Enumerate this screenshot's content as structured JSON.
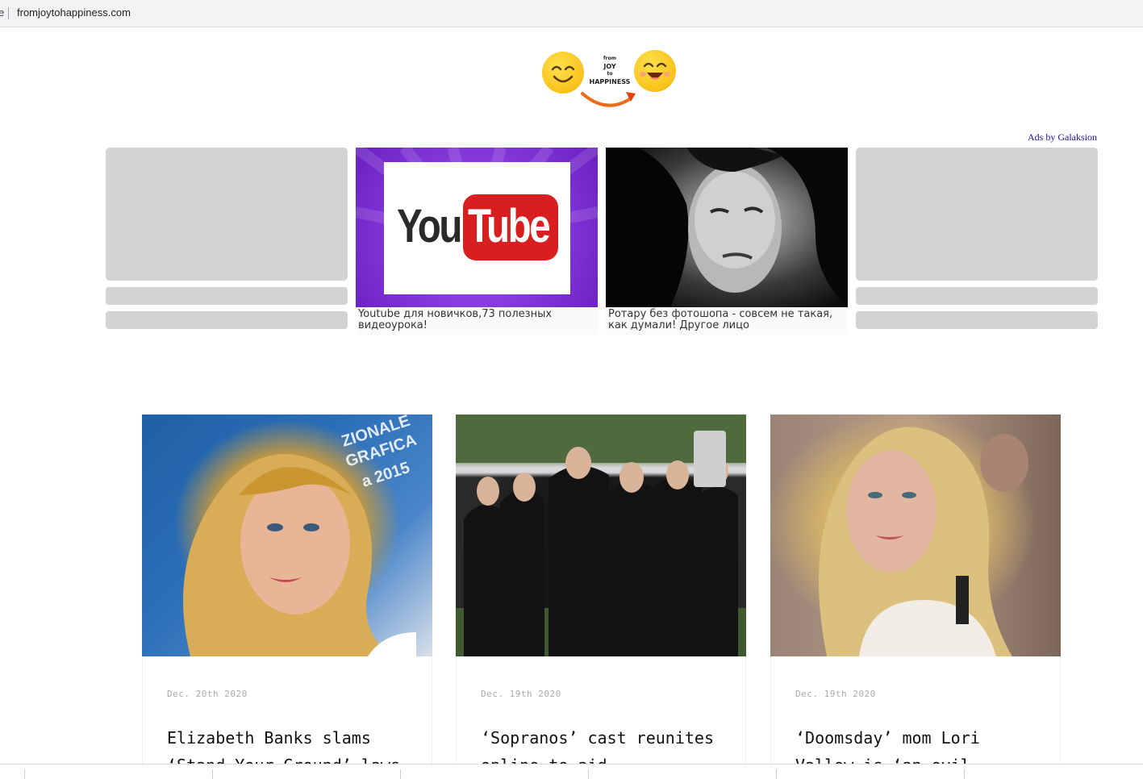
{
  "browser": {
    "edge_char": "e",
    "url": "fromjoytohappiness.com"
  },
  "logo": {
    "line1": "from",
    "line2": "JOY",
    "line3": "to",
    "line4": "HAPPINESS"
  },
  "ads": {
    "label": "Ads by Galaksion",
    "items": [
      {
        "type": "placeholder",
        "caption": ""
      },
      {
        "type": "youtube",
        "image_text_left": "You",
        "image_text_right": "Tube",
        "caption": "Youtube для новичков,73 полезных видеоурока!"
      },
      {
        "type": "photo",
        "caption": "Ротару без фотошопа - совсем не такая, как думали! Другое лицо"
      },
      {
        "type": "placeholder",
        "caption": ""
      }
    ]
  },
  "articles": [
    {
      "date": "Dec. 20th 2020",
      "title": "Elizabeth Banks slams ‘Stand Your Ground’ laws"
    },
    {
      "date": "Dec. 19th 2020",
      "title": "‘Sopranos’ cast reunites online to aid"
    },
    {
      "date": "Dec. 19th 2020",
      "title": "‘Doomsday’ mom Lori Vallow is ‘an evil"
    }
  ],
  "colors": {
    "ad_link": "#1a0dab",
    "placeholder": "#d3d3d3",
    "youtube_red": "#d81f1f",
    "youtube_purple": "#8b3fe0"
  }
}
